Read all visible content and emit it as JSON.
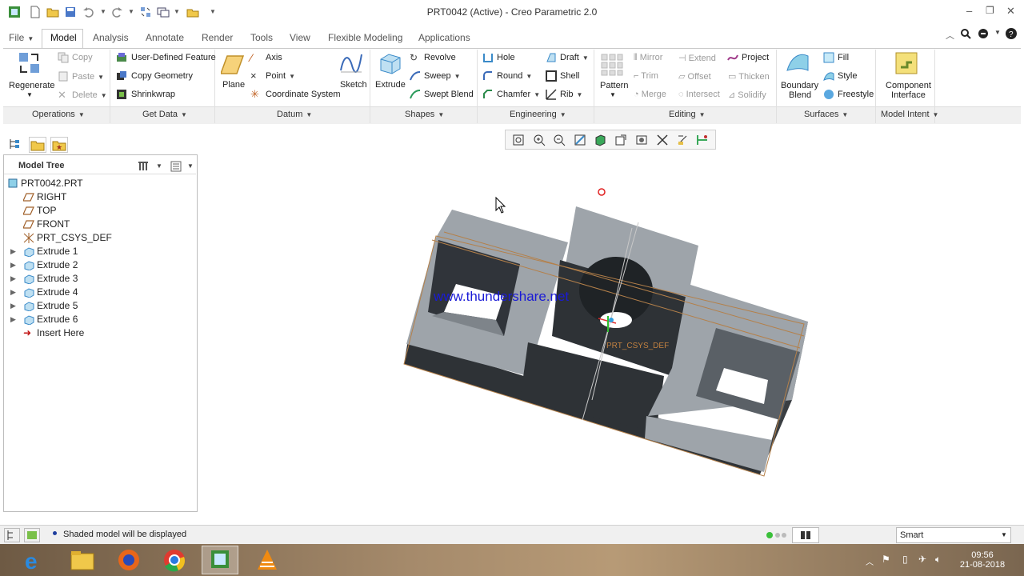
{
  "window": {
    "title": "PRT0042 (Active) - Creo Parametric 2.0"
  },
  "tabs": [
    "File",
    "Model",
    "Analysis",
    "Annotate",
    "Render",
    "Tools",
    "View",
    "Flexible Modeling",
    "Applications"
  ],
  "ribbon": {
    "operations": {
      "regenerate": "Regenerate",
      "copy": "Copy",
      "paste": "Paste",
      "delete": "Delete"
    },
    "get_data": {
      "udf": "User-Defined Feature",
      "copy_geometry": "Copy Geometry",
      "shrinkwrap": "Shrinkwrap"
    },
    "datum": {
      "plane": "Plane",
      "axis": "Axis",
      "point": "Point",
      "csys": "Coordinate System",
      "sketch": "Sketch"
    },
    "shapes": {
      "extrude": "Extrude",
      "revolve": "Revolve",
      "sweep": "Sweep",
      "swept_blend": "Swept Blend"
    },
    "engineering": {
      "hole": "Hole",
      "round": "Round",
      "chamfer": "Chamfer",
      "draft": "Draft",
      "shell": "Shell",
      "rib": "Rib"
    },
    "editing": {
      "pattern": "Pattern",
      "mirror": "Mirror",
      "trim": "Trim",
      "merge": "Merge",
      "extend": "Extend",
      "offset": "Offset",
      "intersect": "Intersect",
      "project": "Project",
      "thicken": "Thicken",
      "solidify": "Solidify"
    },
    "surfaces": {
      "boundary_blend_1": "Boundary",
      "boundary_blend_2": "Blend",
      "fill": "Fill",
      "style": "Style",
      "freestyle": "Freestyle"
    },
    "model_intent": {
      "component_interface_1": "Component",
      "component_interface_2": "Interface"
    },
    "groups": [
      "Operations",
      "Get Data",
      "Datum",
      "Shapes",
      "Engineering",
      "Editing",
      "Surfaces",
      "Model Intent"
    ]
  },
  "model_tree": {
    "title": "Model Tree",
    "items": [
      "PRT0042.PRT",
      "RIGHT",
      "TOP",
      "FRONT",
      "PRT_CSYS_DEF",
      "Extrude 1",
      "Extrude 2",
      "Extrude 3",
      "Extrude 4",
      "Extrude 5",
      "Extrude 6",
      "Insert Here"
    ]
  },
  "viewport": {
    "watermark": "www.thundershare.net",
    "csys_label": "PRT_CSYS_DEF"
  },
  "status": {
    "message": "Shaded model will be displayed",
    "filter": "Smart"
  },
  "taskbar": {
    "time": "09:56",
    "date": "21-08-2018"
  },
  "colors": {
    "accent_blue": "#1f6fd1",
    "model_light": "#9ea4aa",
    "model_dark": "#2e3236",
    "watermark": "#1a1ad6"
  }
}
